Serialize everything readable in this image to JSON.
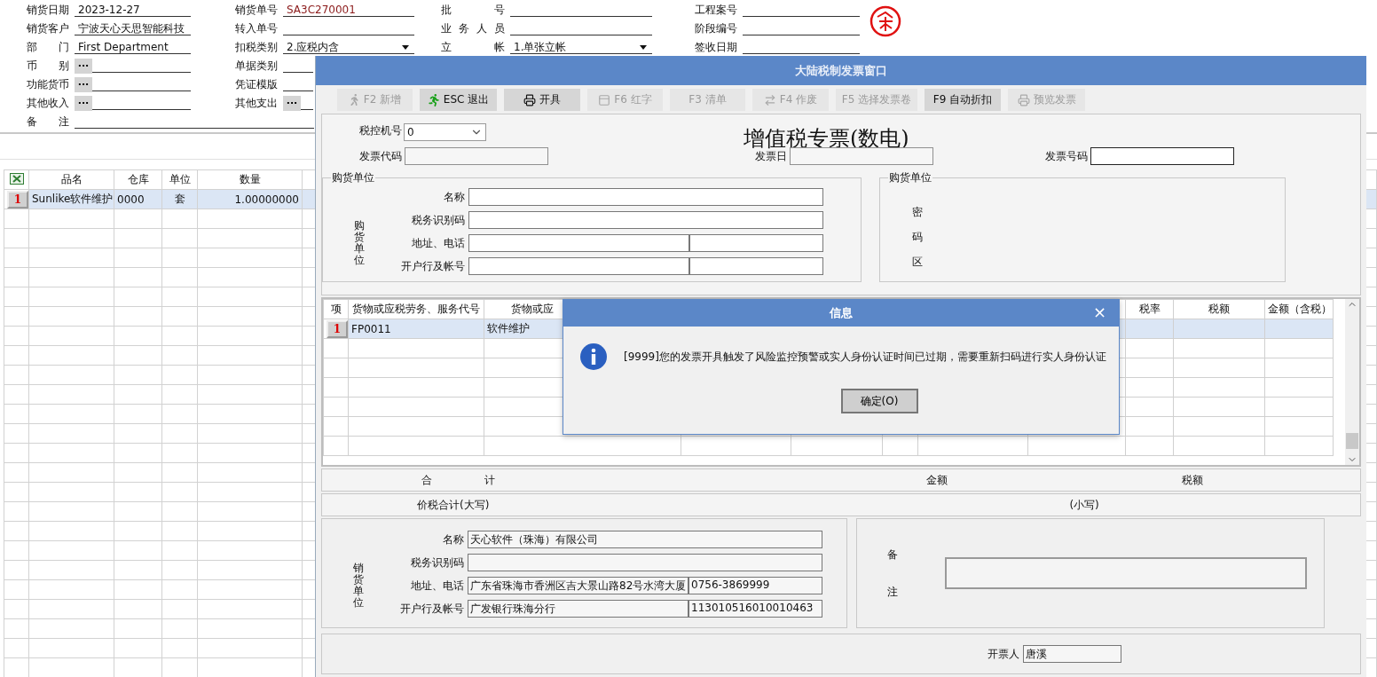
{
  "form": {
    "rows": [
      [
        {
          "label": "销货日期",
          "value": "2023-12-27",
          "kind": "text"
        },
        {
          "label": "销货单号",
          "value": "SA3C270001",
          "kind": "code"
        },
        {
          "label": "批 号",
          "kind": "text"
        },
        {
          "label": "工程案号",
          "kind": "text"
        }
      ],
      [
        {
          "label": "销货客户",
          "value": "宁波天心天思智能科技",
          "kind": "text"
        },
        {
          "label": "转入单号",
          "kind": "text"
        },
        {
          "label": "业务人员",
          "kind": "text"
        },
        {
          "label": "阶段编号",
          "kind": "text"
        }
      ],
      [
        {
          "label": "部 门",
          "value": "First Department",
          "kind": "text"
        },
        {
          "label": "扣税类别",
          "value": "2.应税内含",
          "kind": "dropdown"
        },
        {
          "label": "立 帐",
          "value": "1.单张立帐",
          "kind": "dropdown"
        },
        {
          "label": "签收日期",
          "kind": "text"
        }
      ],
      [
        {
          "label": "币 别",
          "button": "···",
          "kind": "picker"
        },
        {
          "label": "单据类别",
          "kind": "text"
        }
      ],
      [
        {
          "label": "功能货币",
          "button": "···",
          "kind": "picker"
        },
        {
          "label": "凭证模版",
          "kind": "text"
        }
      ],
      [
        {
          "label": "其他收入",
          "button": "···",
          "kind": "picker"
        },
        {
          "label": "其他支出",
          "button": "···",
          "kind": "picker"
        }
      ]
    ],
    "remark": {
      "label": "备 注"
    }
  },
  "detail_table": {
    "columns": [
      "品名",
      "仓库",
      "单位",
      "数量"
    ],
    "rows": [
      {
        "index": "1",
        "cells": [
          "Sunlike软件维护",
          "0000",
          "套",
          "1.00000000"
        ],
        "selected": true
      }
    ]
  },
  "invoice_window": {
    "title": "大陆税制发票窗口",
    "toolbar": [
      {
        "label": "F2 新增",
        "kind": "walk",
        "disabled": true
      },
      {
        "label": "ESC 退出",
        "kind": "run",
        "disabled": false
      },
      {
        "label": "开具",
        "kind": "print",
        "disabled": false
      },
      {
        "label": "F6 红字",
        "kind": "frame",
        "disabled": true
      },
      {
        "label": "F3 清单",
        "kind": "plain",
        "disabled": true
      },
      {
        "label": "F4 作废",
        "kind": "swap",
        "disabled": true
      },
      {
        "label": "F5 选择发票卷",
        "kind": "plain",
        "disabled": true
      },
      {
        "label": "F9 自动折扣",
        "kind": "plain",
        "disabled": false
      },
      {
        "label": "预览发票",
        "kind": "print",
        "disabled": true
      }
    ],
    "machine": {
      "label": "税控机号",
      "value": "0"
    },
    "heading": "增值税专票(数电)",
    "invoice_fields": [
      {
        "label": "发票代码",
        "focused": false
      },
      {
        "label": "发票日",
        "focused": false
      },
      {
        "label": "发票号码",
        "focused": true
      }
    ],
    "buyer": {
      "legend": "购货单位",
      "side_label": "购货单位",
      "rows": [
        {
          "label": "名称"
        },
        {
          "label": "税务识别码"
        },
        {
          "label": "地址、电话",
          "split": true
        },
        {
          "label": "开户行及帐号",
          "split": true
        }
      ]
    },
    "cipher": {
      "legend": "购货单位",
      "side_label": "密码区"
    },
    "items": {
      "columns": [
        {
          "label": "项"
        },
        {
          "label": "货物或应税劳务、服务代号"
        },
        {
          "label": "货物或应"
        },
        {},
        {},
        {},
        {},
        {},
        {
          "label": "税率"
        },
        {
          "label": "税额"
        },
        {
          "label": "金额（含税）"
        }
      ],
      "rows": [
        {
          "cells": [
            "1",
            "FP0011",
            "软件维护"
          ],
          "selected": true
        }
      ]
    },
    "totals": {
      "total_label": "合 计",
      "amount_label": "金额",
      "tax_label": "税额",
      "upper_label": "价税合计(大写)",
      "lower_label": "(小写)"
    },
    "seller": {
      "side_label": "销货单位",
      "rows": [
        {
          "label": "名称",
          "value": "天心软件（珠海）有限公司"
        },
        {
          "label": "税务识别码"
        },
        {
          "label": "地址、电话",
          "value": "广东省珠海市香洲区吉大景山路82号水湾大厦",
          "value2": "0756-3869999"
        },
        {
          "label": "开户行及帐号",
          "value": "广发银行珠海分行",
          "value2": "113010516010010463"
        }
      ]
    },
    "remarks": {
      "label": "备注"
    },
    "issuer": {
      "label": "开票人",
      "value": "唐溪"
    }
  },
  "message_dialog": {
    "title": "信息",
    "close": "×",
    "message": "[9999]您的发票开具触发了风险监控预警或实人身份认证时间已过期，需要重新扫码进行实人身份认证",
    "button": "确定(O)"
  }
}
